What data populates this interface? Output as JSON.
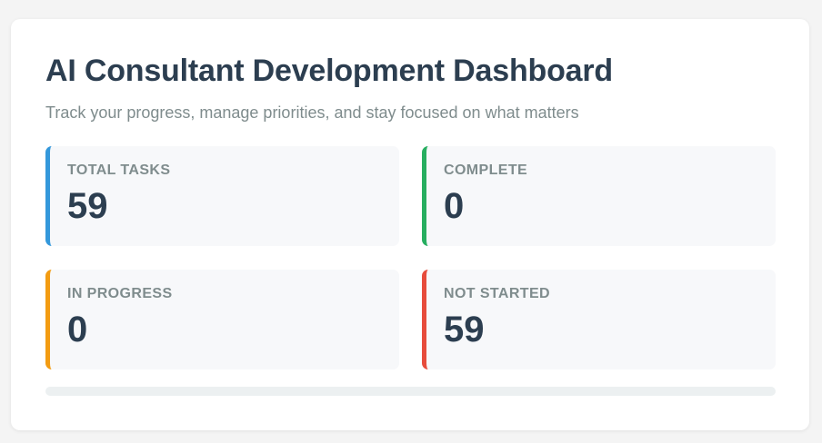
{
  "dashboard": {
    "title": "AI Consultant Development Dashboard",
    "subtitle": "Track your progress, manage priorities, and stay focused on what matters"
  },
  "stats": [
    {
      "label": "TOTAL TASKS",
      "value": "59",
      "accent": "#3498db"
    },
    {
      "label": "COMPLETE",
      "value": "0",
      "accent": "#27ae60"
    },
    {
      "label": "IN PROGRESS",
      "value": "0",
      "accent": "#f39c12"
    },
    {
      "label": "NOT STARTED",
      "value": "59",
      "accent": "#e74c3c"
    }
  ],
  "progress": {
    "fraction_complete": 0,
    "fill_color": "#27ae60"
  }
}
